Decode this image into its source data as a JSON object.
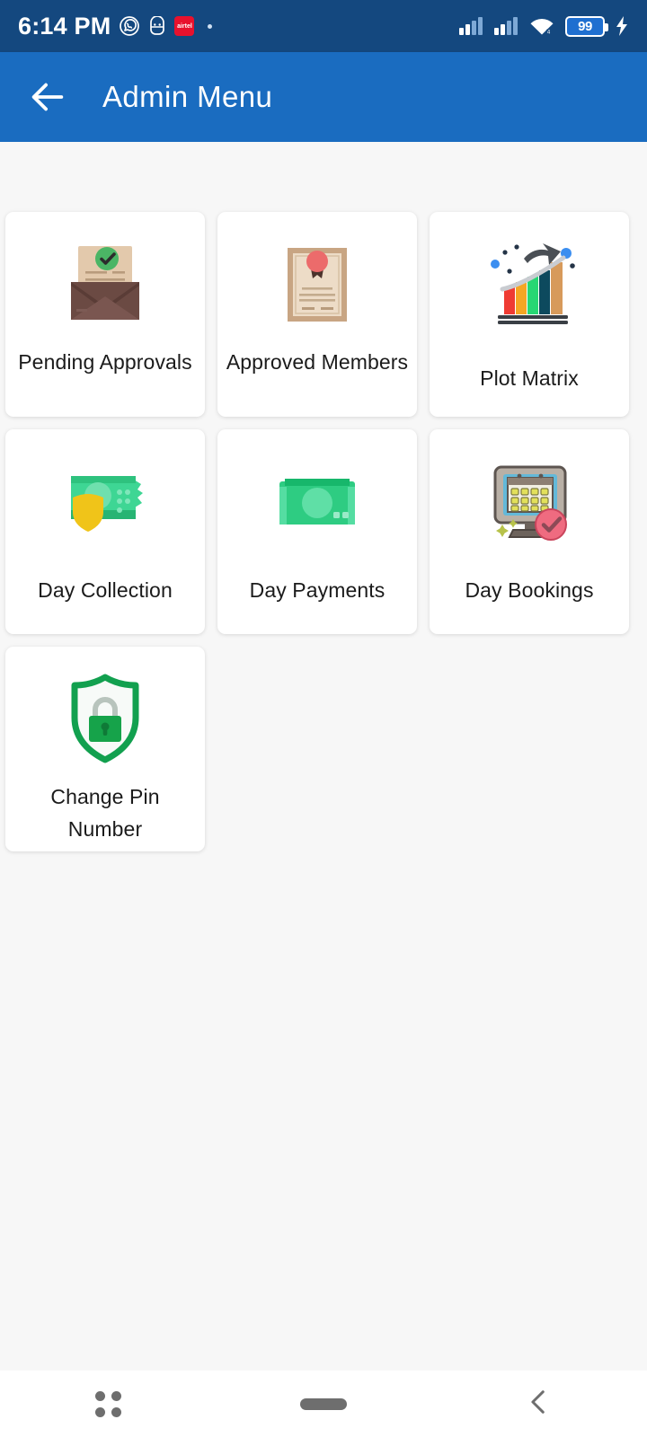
{
  "status_bar": {
    "time": "6:14 PM",
    "left_icons": [
      "whatsapp-icon",
      "app-icon",
      "airtel-icon",
      "dot-indicator"
    ],
    "airtel_label": "airtel",
    "right_icons": [
      "signal-1-icon",
      "signal-2-icon",
      "wifi-icon",
      "battery-icon",
      "charging-bolt-icon"
    ],
    "battery_level": "99",
    "background_color": "#14487f"
  },
  "app_bar": {
    "title": "Admin Menu",
    "back_icon": "arrow-left-icon",
    "background_color": "#1a6cc0",
    "text_color": "#ffffff"
  },
  "menu": {
    "items": [
      {
        "label": "Pending Approvals",
        "icon": "envelope-check-icon",
        "lines": 2
      },
      {
        "label": "Approved Members",
        "icon": "certificate-seal-icon",
        "lines": 2
      },
      {
        "label": "Plot Matrix",
        "icon": "bar-chart-growth-icon",
        "lines": 1
      },
      {
        "label": "Day Collection",
        "icon": "money-shield-icon",
        "lines": 1
      },
      {
        "label": "Day Payments",
        "icon": "banknote-icon",
        "lines": 1
      },
      {
        "label": "Day Bookings",
        "icon": "monitor-calendar-check-icon",
        "lines": 1
      },
      {
        "label": "Change Pin Number",
        "icon": "shield-lock-icon",
        "lines": 2
      }
    ],
    "card_background": "#ffffff",
    "page_background": "#f7f7f7",
    "label_color": "#1b1b1b"
  },
  "nav_bar": {
    "recents_icon": "four-dots-icon",
    "home_icon": "home-pill-icon",
    "back_icon": "chevron-left-icon",
    "background_color": "#ffffff"
  }
}
